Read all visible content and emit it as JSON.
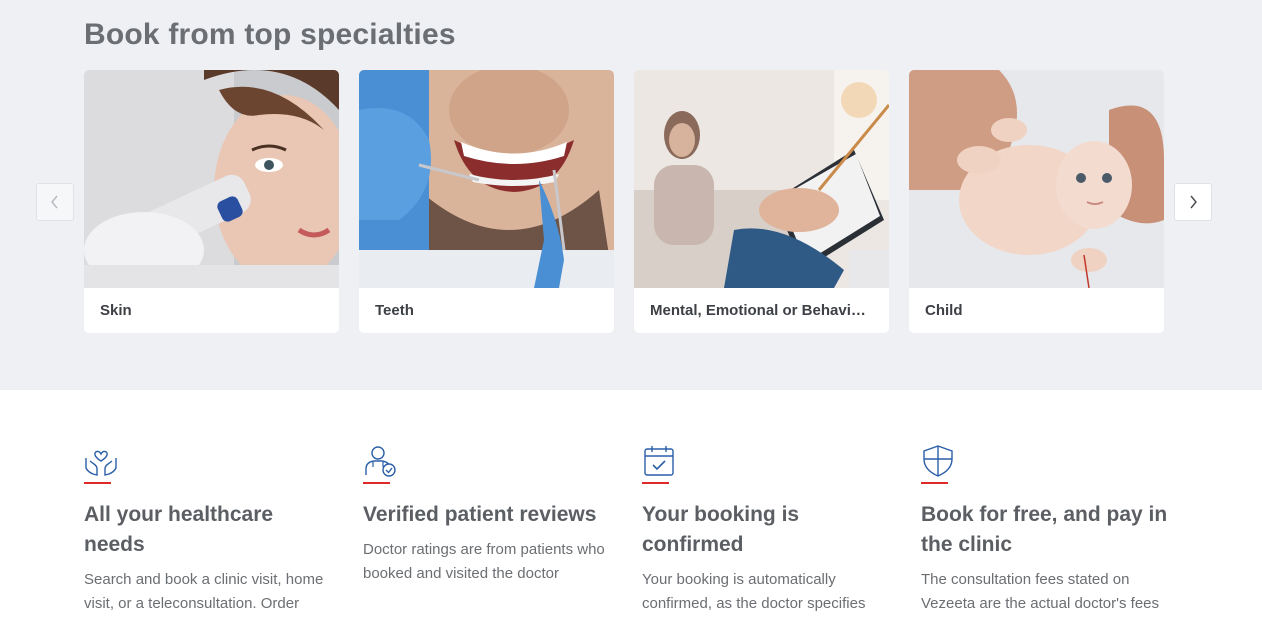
{
  "specialties": {
    "title": "Book from top specialties",
    "prev_icon": "chevron-left-icon",
    "next_icon": "chevron-right-icon",
    "cards": [
      {
        "label": "Skin",
        "image": "woman-skin-treatment-photo"
      },
      {
        "label": "Teeth",
        "image": "smiling-man-dental-photo"
      },
      {
        "label": "Mental, Emotional or Behavioral Disorders",
        "image": "therapy-session-photo"
      },
      {
        "label": "Child",
        "image": "baby-photo"
      }
    ]
  },
  "features": [
    {
      "icon": "hands-heart-icon",
      "title": "All your healthcare needs",
      "description": "Search and book a clinic visit, home visit, or a teleconsultation. Order"
    },
    {
      "icon": "doctor-check-icon",
      "title": "Verified patient reviews",
      "description": "Doctor ratings are from patients who booked and visited the doctor"
    },
    {
      "icon": "calendar-check-icon",
      "title": "Your booking is confirmed",
      "description": "Your booking is automatically confirmed, as the doctor specifies"
    },
    {
      "icon": "shield-icon",
      "title": "Book for free, and pay in the clinic",
      "description": "The consultation fees stated on Vezeeta are the actual doctor's fees"
    }
  ],
  "colors": {
    "accent_red": "#e02a2a",
    "icon_blue": "#2a5fa8",
    "section_bg": "#eef0f3"
  }
}
